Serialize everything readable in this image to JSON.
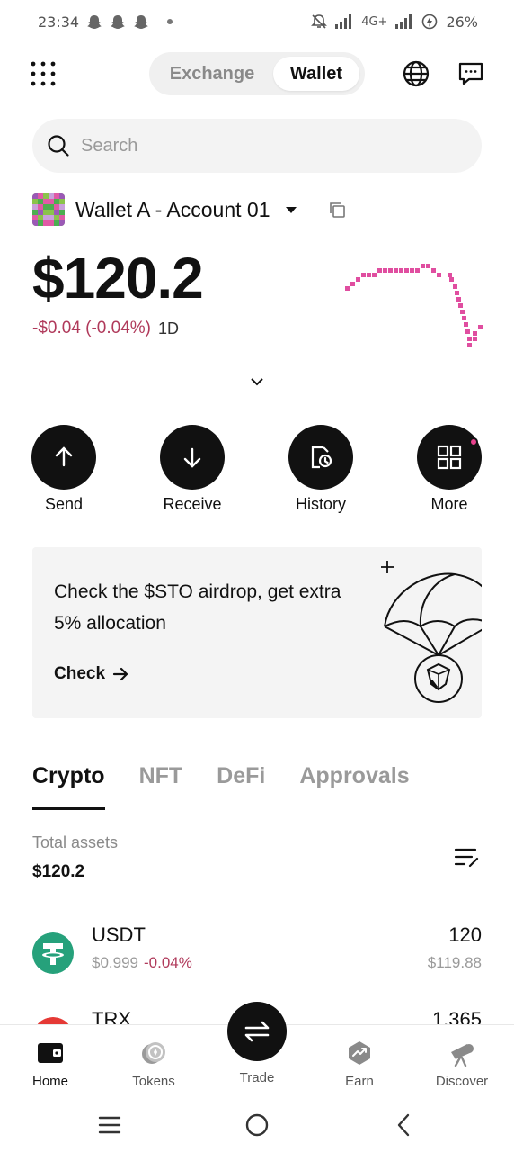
{
  "status_bar": {
    "time": "23:34",
    "network": "4G+",
    "battery": "26%"
  },
  "header": {
    "segments": [
      "Exchange",
      "Wallet"
    ],
    "active_segment": "Wallet"
  },
  "search": {
    "placeholder": "Search"
  },
  "account": {
    "name": "Wallet A - Account 01"
  },
  "portfolio": {
    "balance": "$120.2",
    "change": "-$0.04 (-0.04%)",
    "period": "1D"
  },
  "actions": [
    {
      "label": "Send",
      "icon": "arrow-up-icon"
    },
    {
      "label": "Receive",
      "icon": "arrow-down-icon"
    },
    {
      "label": "History",
      "icon": "history-icon"
    },
    {
      "label": "More",
      "icon": "apps-grid-icon"
    }
  ],
  "banner": {
    "text": "Check the $STO airdrop, get extra 5% allocation",
    "cta": "Check"
  },
  "tabs": [
    "Crypto",
    "NFT",
    "DeFi",
    "Approvals"
  ],
  "active_tab": "Crypto",
  "assets": {
    "total_label": "Total assets",
    "total_value": "$120.2"
  },
  "tokens": [
    {
      "symbol": "USDT",
      "price": "$0.999",
      "change": "-0.04%",
      "amount": "120",
      "value": "$119.88",
      "color": "#26a17b"
    },
    {
      "symbol": "TRX",
      "amount": "1.365",
      "color": "#e53935"
    }
  ],
  "bottom_nav": [
    {
      "label": "Home",
      "icon": "wallet-icon"
    },
    {
      "label": "Tokens",
      "icon": "tokens-icon"
    },
    {
      "label": "Trade",
      "icon": "swap-icon"
    },
    {
      "label": "Earn",
      "icon": "earn-icon"
    },
    {
      "label": "Discover",
      "icon": "telescope-icon"
    }
  ],
  "colors": {
    "accent_negative": "#b03a5b",
    "sparkline": "#e04ea0",
    "badge": "#e8408c"
  }
}
